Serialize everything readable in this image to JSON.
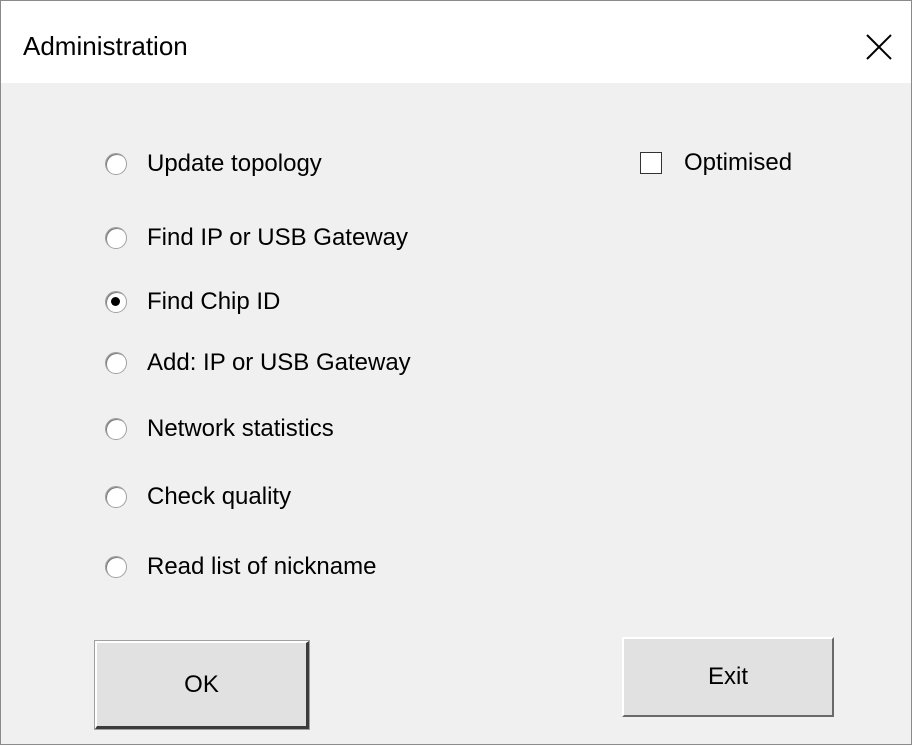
{
  "window": {
    "title": "Administration"
  },
  "options": [
    {
      "label": "Update topology",
      "checked": false
    },
    {
      "label": "Find IP or USB Gateway",
      "checked": false
    },
    {
      "label": "Find Chip ID",
      "checked": true
    },
    {
      "label": "Add: IP or USB Gateway",
      "checked": false
    },
    {
      "label": "Network statistics",
      "checked": false
    },
    {
      "label": "Check quality",
      "checked": false
    },
    {
      "label": "Read list of nickname",
      "checked": false
    }
  ],
  "optimised": {
    "label": "Optimised",
    "checked": false
  },
  "buttons": {
    "ok_label": "OK",
    "exit_label": "Exit"
  }
}
